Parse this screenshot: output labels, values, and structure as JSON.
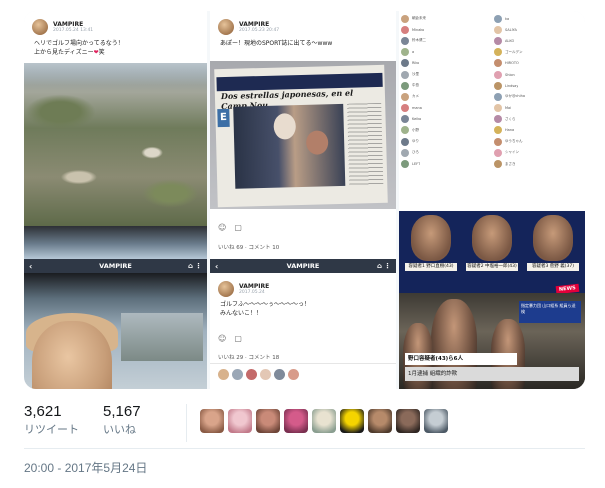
{
  "post1": {
    "author": "VAMPIRE",
    "time": "2017.05.24 13:41 ",
    "text": "ヘリでゴルフ場向かってるなう！\n上から見たディズニー",
    "emoji_after": "笑"
  },
  "post2": {
    "author": "VAMPIRE",
    "time": "2017.05.23 20:47 ",
    "text": "あぽー！現地のSPORT誌に出てる〜www",
    "newspaper_headline": "Dos estrellas japonesas, en el Camp Nou",
    "likes": "いいね 69",
    "comments": "コメント 10"
  },
  "line_header_left": "VAMPIRE",
  "line_header_mid": "VAMPIRE",
  "post3": {
    "author": "VAMPIRE",
    "time": "2017.05.24 ",
    "text": "ゴルフふ〜〜〜〜ぅ〜〜〜〜っ！\nみんないこ！！",
    "likes": "いいね 29",
    "comments": "コメント 18"
  },
  "follower_list": [
    "朝倉未来",
    "ka",
    "Minako",
    "SALIYA",
    "鈴木健二",
    "ALKO",
    "a",
    "ゴールデン",
    "Riko",
    "HIROTO",
    "沙里",
    "Shion",
    "中島",
    "Lindsay",
    "カメ",
    "ゆか@chiha",
    "mana",
    "Mai",
    "Keiko",
    "さくら",
    "小野",
    "Hana",
    "ゆり",
    "ゆうちゃん",
    "ひろ",
    "シャイン",
    "LEFT",
    "まさき"
  ],
  "tv": {
    "mug1_label": "容疑者1  野口直樹(43)",
    "mug2_label": "容疑者2  中塩裕一郎(43)",
    "mug3_label": "容疑者3  菅野 義(37)",
    "badge": "NEWS",
    "topbox": "指定暴力団 山口組系 組員ら送検",
    "caption": "野口容疑者(43)ら6人",
    "caption2": "1月逮捕 組織的詐欺"
  },
  "stats": {
    "retweets_count": "3,621",
    "retweets_label": "リツイート",
    "likes_count": "5,167",
    "likes_label": "いいね"
  },
  "likers": [
    "liker-1",
    "liker-2",
    "liker-3",
    "liker-4",
    "liker-5",
    "liker-6",
    "liker-7",
    "liker-8",
    "liker-9"
  ],
  "timestamp": "20:00 - 2017年5月24日"
}
